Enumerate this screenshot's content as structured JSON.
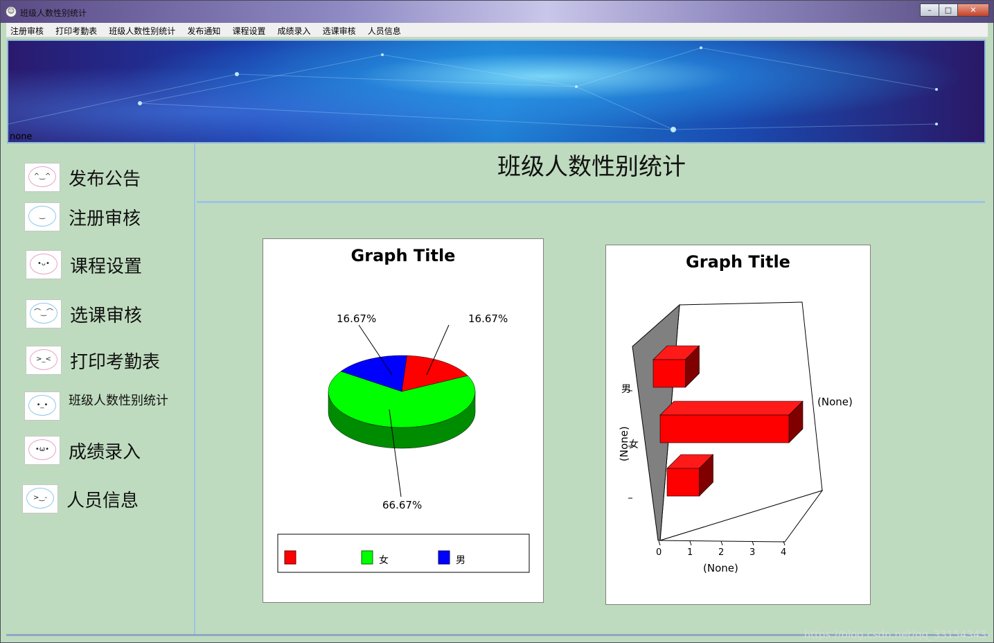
{
  "window": {
    "title": "班级人数性别统计",
    "icon": "smiley-icon"
  },
  "titlebar_buttons": {
    "minimize": "–",
    "maximize": "□",
    "close": "✕"
  },
  "menu": [
    "注册审核",
    "打印考勤表",
    "班级人数性别统计",
    "发布通知",
    "课程设置",
    "成绩录入",
    "选课审核",
    "人员信息"
  ],
  "banner": {
    "label": "none"
  },
  "sidebar": {
    "items": [
      {
        "label": "发布公告",
        "face": "^‿^"
      },
      {
        "label": "注册审核",
        "face": "‿"
      },
      {
        "label": "课程设置",
        "face": "•ᴗ•"
      },
      {
        "label": "选课审核",
        "face": "⌒‿⌒"
      },
      {
        "label": "打印考勤表",
        "face": ">_<"
      },
      {
        "label": "班级人数性别统计",
        "face": "•_•"
      },
      {
        "label": "成绩录入",
        "face": "•ω•"
      },
      {
        "label": "人员信息",
        "face": ">‿-"
      }
    ]
  },
  "main": {
    "title": "班级人数性别统计"
  },
  "pie_chart": {
    "title": "Graph Title",
    "slice_labels": [
      "16.67%",
      "16.67%",
      "66.67%"
    ],
    "legend": [
      {
        "label": "",
        "color": "#ff0000"
      },
      {
        "label": "女",
        "color": "#00ff00"
      },
      {
        "label": "男",
        "color": "#0000ff"
      }
    ]
  },
  "bar_chart": {
    "title": "Graph Title",
    "y_axis_label": "(None)",
    "x_axis_label": "(None)",
    "series_label": "(None)",
    "category_labels": [
      "男",
      "女"
    ],
    "x_ticks": [
      "0",
      "1",
      "2",
      "3",
      "4"
    ]
  },
  "chart_data": [
    {
      "type": "pie",
      "title": "Graph Title",
      "categories": [
        "",
        "女",
        "男"
      ],
      "values": [
        16.67,
        66.67,
        16.67
      ],
      "colors": [
        "#ff0000",
        "#00ff00",
        "#0000ff"
      ],
      "legend_position": "bottom"
    },
    {
      "type": "bar",
      "orientation": "horizontal",
      "title": "Graph Title",
      "xlabel": "(None)",
      "ylabel": "(None)",
      "categories": [
        "男",
        "",
        "女"
      ],
      "series": [
        {
          "name": "(None)",
          "values": [
            1,
            4,
            1
          ]
        }
      ],
      "xlim": [
        0,
        4
      ]
    }
  ],
  "watermark": "https://blog.csdn.net/qq_33154343"
}
